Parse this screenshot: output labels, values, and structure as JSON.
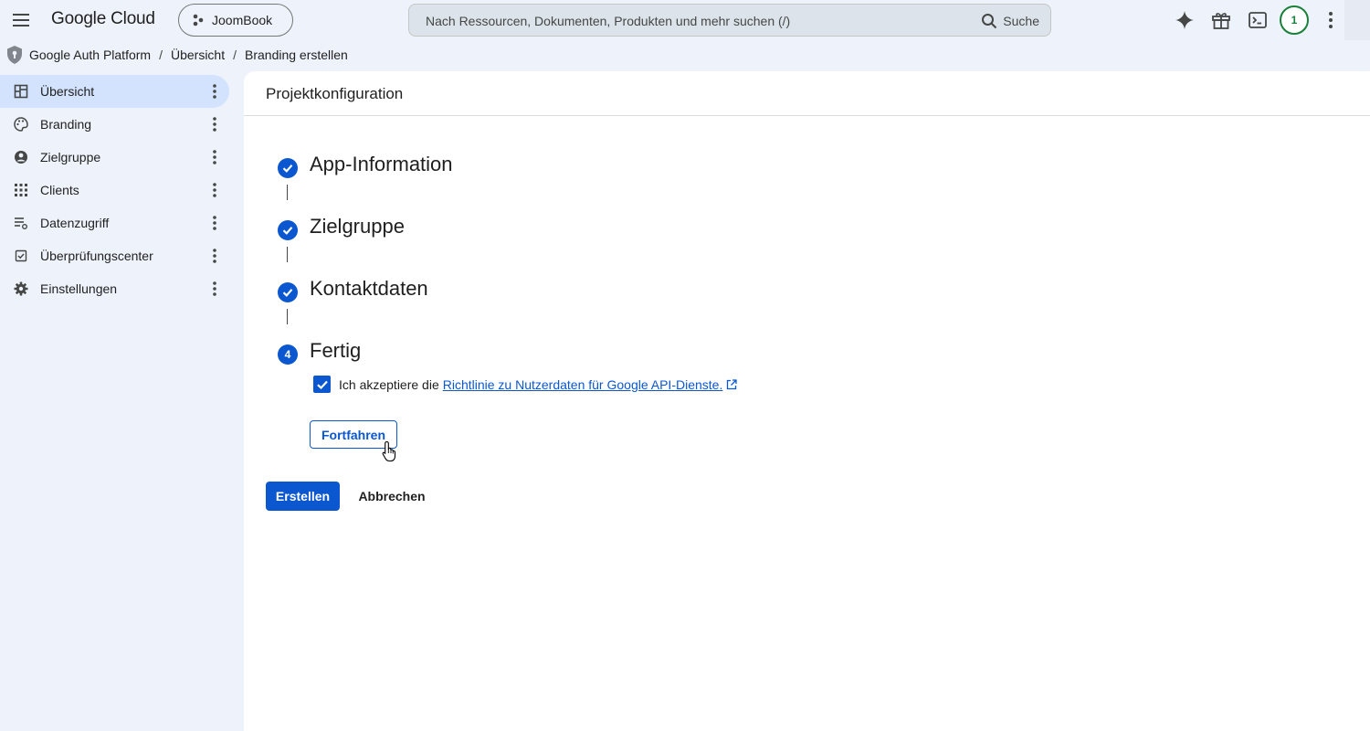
{
  "header": {
    "logo": "Google Cloud",
    "project": "JoomBook",
    "search_placeholder": "Nach Ressourcen, Dokumenten, Produkten und mehr suchen (/)",
    "search_button": "Suche",
    "notification_count": "1"
  },
  "breadcrumb": {
    "items": [
      "Google Auth Platform",
      "Übersicht",
      "Branding erstellen"
    ],
    "separator": "/"
  },
  "sidebar": {
    "items": [
      {
        "label": "Übersicht",
        "icon": "dashboard-icon",
        "active": true
      },
      {
        "label": "Branding",
        "icon": "palette-icon",
        "active": false
      },
      {
        "label": "Zielgruppe",
        "icon": "account-circle-icon",
        "active": false
      },
      {
        "label": "Clients",
        "icon": "apps-grid-icon",
        "active": false
      },
      {
        "label": "Datenzugriff",
        "icon": "data-access-icon",
        "active": false
      },
      {
        "label": "Überprüfungscenter",
        "icon": "verification-icon",
        "active": false
      },
      {
        "label": "Einstellungen",
        "icon": "gear-icon",
        "active": false
      }
    ]
  },
  "main": {
    "title": "Projektkonfiguration",
    "steps": [
      {
        "label": "App-Information",
        "status": "done"
      },
      {
        "label": "Zielgruppe",
        "status": "done"
      },
      {
        "label": "Kontaktdaten",
        "status": "done"
      },
      {
        "label": "Fertig",
        "status": "current",
        "number": "4"
      }
    ],
    "consent_text": "Ich akzeptiere die",
    "consent_link": "Richtlinie zu Nutzerdaten für Google API-Dienste.",
    "consent_checked": true,
    "continue_label": "Fortfahren",
    "create_label": "Erstellen",
    "cancel_label": "Abbrechen"
  },
  "colors": {
    "accent": "#0b57d0",
    "sidebar_active": "#d3e3fd",
    "background": "#eef3fb",
    "avatar_ring": "#188038"
  }
}
